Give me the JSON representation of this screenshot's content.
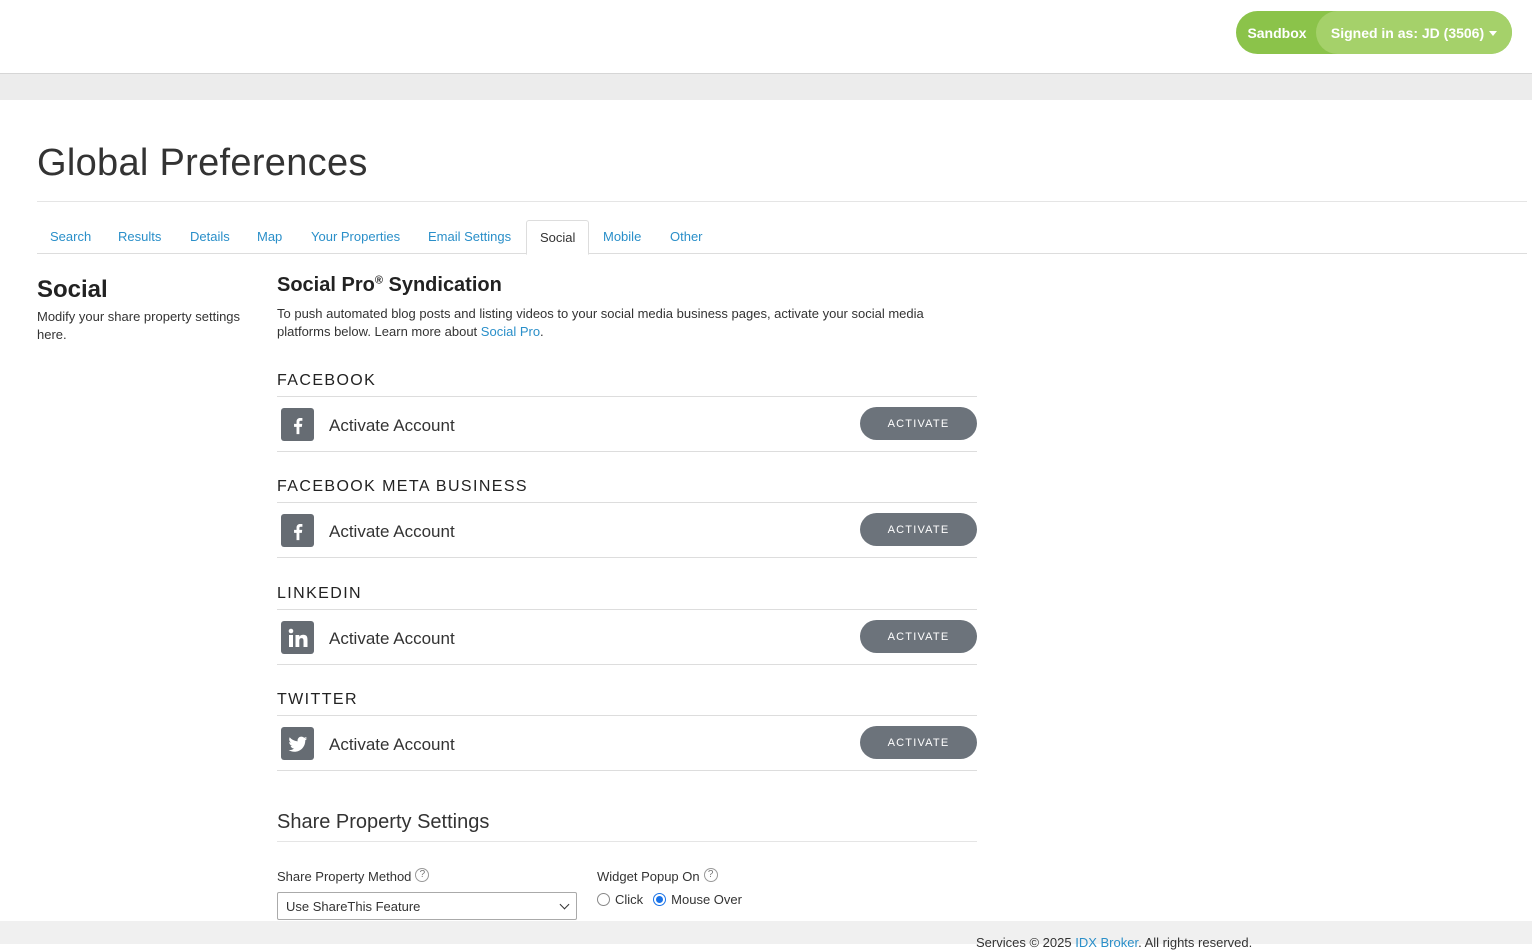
{
  "header": {
    "env_label": "Sandbox",
    "user_label": "Signed in as: JD (3506)",
    "accent_color": "#8bc34a"
  },
  "page": {
    "title": "Global Preferences"
  },
  "tabs": [
    {
      "label": "Search",
      "active": false
    },
    {
      "label": "Results",
      "active": false
    },
    {
      "label": "Details",
      "active": false
    },
    {
      "label": "Map",
      "active": false
    },
    {
      "label": "Your Properties",
      "active": false
    },
    {
      "label": "Email Settings",
      "active": false
    },
    {
      "label": "Social",
      "active": true
    },
    {
      "label": "Mobile",
      "active": false
    },
    {
      "label": "Other",
      "active": false
    }
  ],
  "sidebar": {
    "title": "Social",
    "description": "Modify your share property settings here."
  },
  "social_pro": {
    "title": "Social Pro",
    "reg_mark": "®",
    "title_suffix": "Syndication",
    "description": "To push automated blog posts and listing videos to your social media business pages, activate your social media platforms below. Learn more about",
    "link_text": "Social Pro",
    "after_link": "."
  },
  "accounts": [
    {
      "heading": "FACEBOOK",
      "icon": "facebook-icon",
      "label": "Activate Account",
      "button": "ACTIVATE"
    },
    {
      "heading": "FACEBOOK META BUSINESS",
      "icon": "facebook-icon",
      "label": "Activate Account",
      "button": "ACTIVATE"
    },
    {
      "heading": "LINKEDIN",
      "icon": "linkedin-icon",
      "label": "Activate Account",
      "button": "ACTIVATE"
    },
    {
      "heading": "TWITTER",
      "icon": "twitter-icon",
      "label": "Activate Account",
      "button": "ACTIVATE"
    }
  ],
  "share_settings": {
    "title": "Share Property Settings",
    "method_label": "Share Property Method",
    "method_value": "Use ShareThis Feature",
    "popup_label": "Widget Popup On",
    "popup_options": [
      "Click",
      "Mouse Over"
    ],
    "popup_selected": "Mouse Over"
  },
  "footer": {
    "prefix": "Services © 2025",
    "link": "IDX Broker",
    "suffix": ". All rights reserved."
  }
}
